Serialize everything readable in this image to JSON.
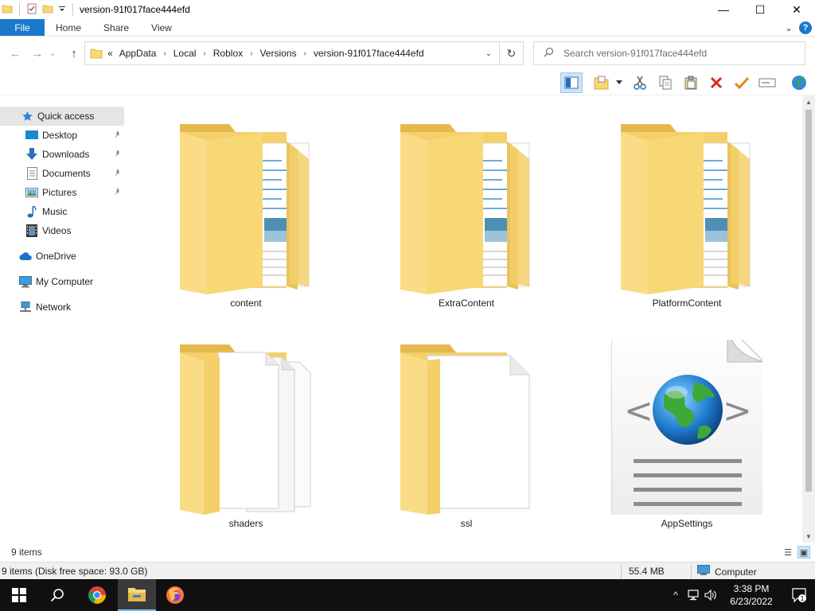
{
  "window": {
    "title": "version-91f017face444efd",
    "controls": {
      "minimize": "—",
      "maximize": "☐",
      "close": "✕"
    }
  },
  "ribbon": {
    "file": "File",
    "tabs": [
      "Home",
      "Share",
      "View"
    ],
    "expand": "⌄",
    "help": "?"
  },
  "address": {
    "prefix": "«",
    "crumbs": [
      "AppData",
      "Local",
      "Roblox",
      "Versions",
      "version-91f017face444efd"
    ],
    "separator": "›",
    "dropdown": "⌄",
    "refresh": "↻"
  },
  "search": {
    "placeholder": "Search version-91f017face444efd"
  },
  "nav": {
    "back": "←",
    "forward": "→",
    "recent": "⌄",
    "up": "↑"
  },
  "sidebar": {
    "quick_access": "Quick access",
    "items": [
      {
        "label": "Desktop",
        "icon": "desktop-icon",
        "pinned": true
      },
      {
        "label": "Downloads",
        "icon": "download-icon",
        "pinned": true
      },
      {
        "label": "Documents",
        "icon": "documents-icon",
        "pinned": true
      },
      {
        "label": "Pictures",
        "icon": "pictures-icon",
        "pinned": true
      },
      {
        "label": "Music",
        "icon": "music-icon",
        "pinned": false
      },
      {
        "label": "Videos",
        "icon": "videos-icon",
        "pinned": false
      }
    ],
    "onedrive": "OneDrive",
    "my_computer": "My Computer",
    "network": "Network",
    "pin_glyph": "📌"
  },
  "files": [
    {
      "name": "content",
      "type": "folder-docs"
    },
    {
      "name": "ExtraContent",
      "type": "folder-docs"
    },
    {
      "name": "PlatformContent",
      "type": "folder-docs"
    },
    {
      "name": "shaders",
      "type": "folder-pages"
    },
    {
      "name": "ssl",
      "type": "folder-page"
    },
    {
      "name": "AppSettings",
      "type": "xml-file"
    }
  ],
  "status": {
    "item_count": "9 items",
    "disk_info": "9 items (Disk free space: 93.0 GB)",
    "size": "55.4 MB",
    "location": "Computer"
  },
  "taskbar": {
    "time": "3:38 PM",
    "date": "6/23/2022",
    "notification_count": "1",
    "tray_expand": "^"
  },
  "colors": {
    "accent": "#1979ca",
    "folder_back": "#e8c15a",
    "folder_front": "#f8d775",
    "taskbar": "#101010"
  }
}
